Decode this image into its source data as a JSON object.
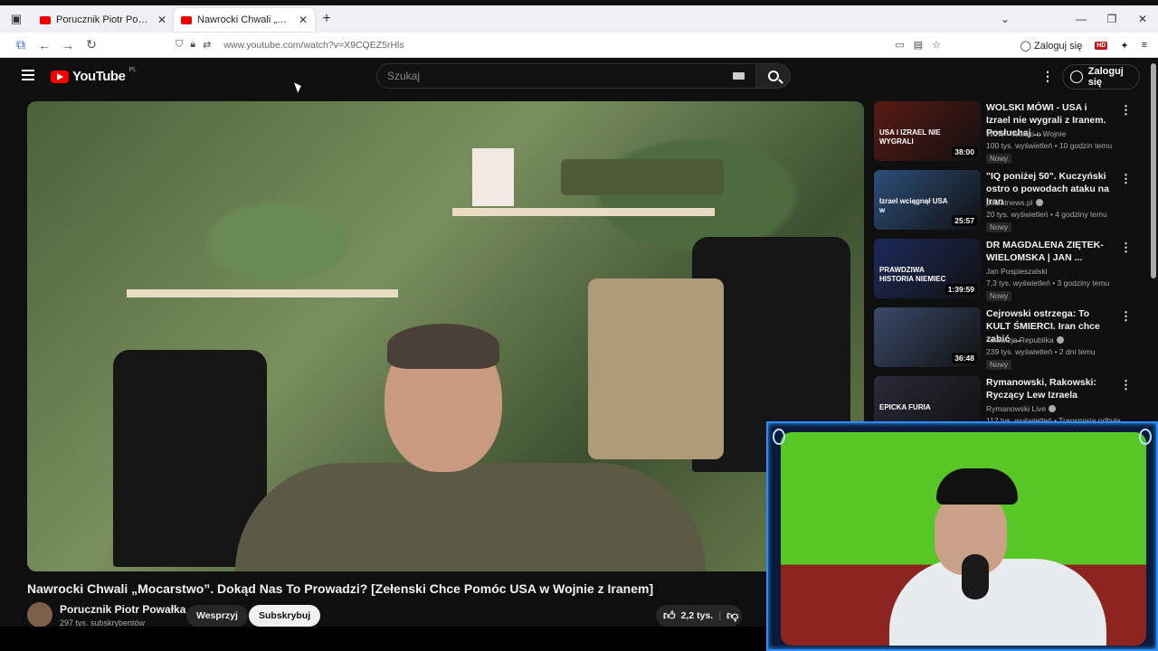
{
  "browser": {
    "tabs": [
      {
        "title": "Porucznik Piotr Powałka - YouTu"
      },
      {
        "title": "Nawrocki Chwali „Mocarstwo”. D"
      }
    ],
    "url": "www.youtube.com/watch?v=X9CQEZ5rHls",
    "signin_label": "Zaloguj się",
    "hd_badge": "HD"
  },
  "youtube": {
    "logo_text": "YouTube",
    "region": "PL",
    "search_placeholder": "Szukaj",
    "signin_label": "Zaloguj się"
  },
  "video": {
    "title": "Nawrocki Chwali „Mocarstwo”. Dokąd Nas To Prowadzi? [Zełenski Chce Pomóc USA w Wojnie z Iranem]",
    "channel_name": "Porucznik Piotr Powałka",
    "subscribers": "297 tys. subskrybentów",
    "support_label": "Wesprzyj",
    "subscribe_label": "Subskrybuj",
    "likes": "2,2 tys."
  },
  "recommendations": [
    {
      "title": "WOLSKI MÓWI - USA i Izrael nie wygrali z Iranem. Posłuchaj ...",
      "channel": "WoW - Wolski o Wojnie",
      "meta": "100 tys. wyświetleń • 10 godzin temu",
      "badge": "Nowy",
      "duration": "38:00",
      "thumb_text": "USA I IZRAEL NIE WYGRALI",
      "thumb_color": "#5a1a14"
    },
    {
      "title": "\"IQ poniżej 50\". Kuczyński ostro o powodach ataku na Iran",
      "channel": "polsatnews.pl",
      "meta": "20 tys. wyświetleń • 4 godziny temu",
      "badge": "Nowy",
      "duration": "25:57",
      "thumb_text": "Izrael wciągnął USA w",
      "thumb_color": "#2e4f7a"
    },
    {
      "title": "DR MAGDALENA ZIĘTEK-WIELOMSKA | JAN ...",
      "channel": "Jan Pospieszalski",
      "meta": "7,3 tys. wyświetleń • 3 godziny temu",
      "badge": "Nowy",
      "duration": "1:39:59",
      "thumb_text": "PRAWDZIWA HISTORIA NIEMIEC",
      "thumb_color": "#1d2a5a"
    },
    {
      "title": "Cejrowski ostrzega: To KULT ŚMIERCI. Iran chce zabić ...",
      "channel": "Telewizja Republika",
      "meta": "239 tys. wyświetleń • 2 dni temu",
      "badge": "Nowy",
      "duration": "36:48",
      "thumb_text": "",
      "thumb_color": "#3a4a6a"
    },
    {
      "title": "Rymanowski, Rakowski: Ryczący Lew Izraela",
      "channel": "Rymanowski Live",
      "meta": "112 tys. wyświetleń • Transmisja odbyła",
      "badge": "",
      "duration": "",
      "thumb_text": "EPICKA FURIA",
      "thumb_color": "#2a2a3a"
    }
  ],
  "colors": {
    "accent": "#ff0000",
    "cam_border": "#2a8cff",
    "green_screen": "#58c624"
  }
}
